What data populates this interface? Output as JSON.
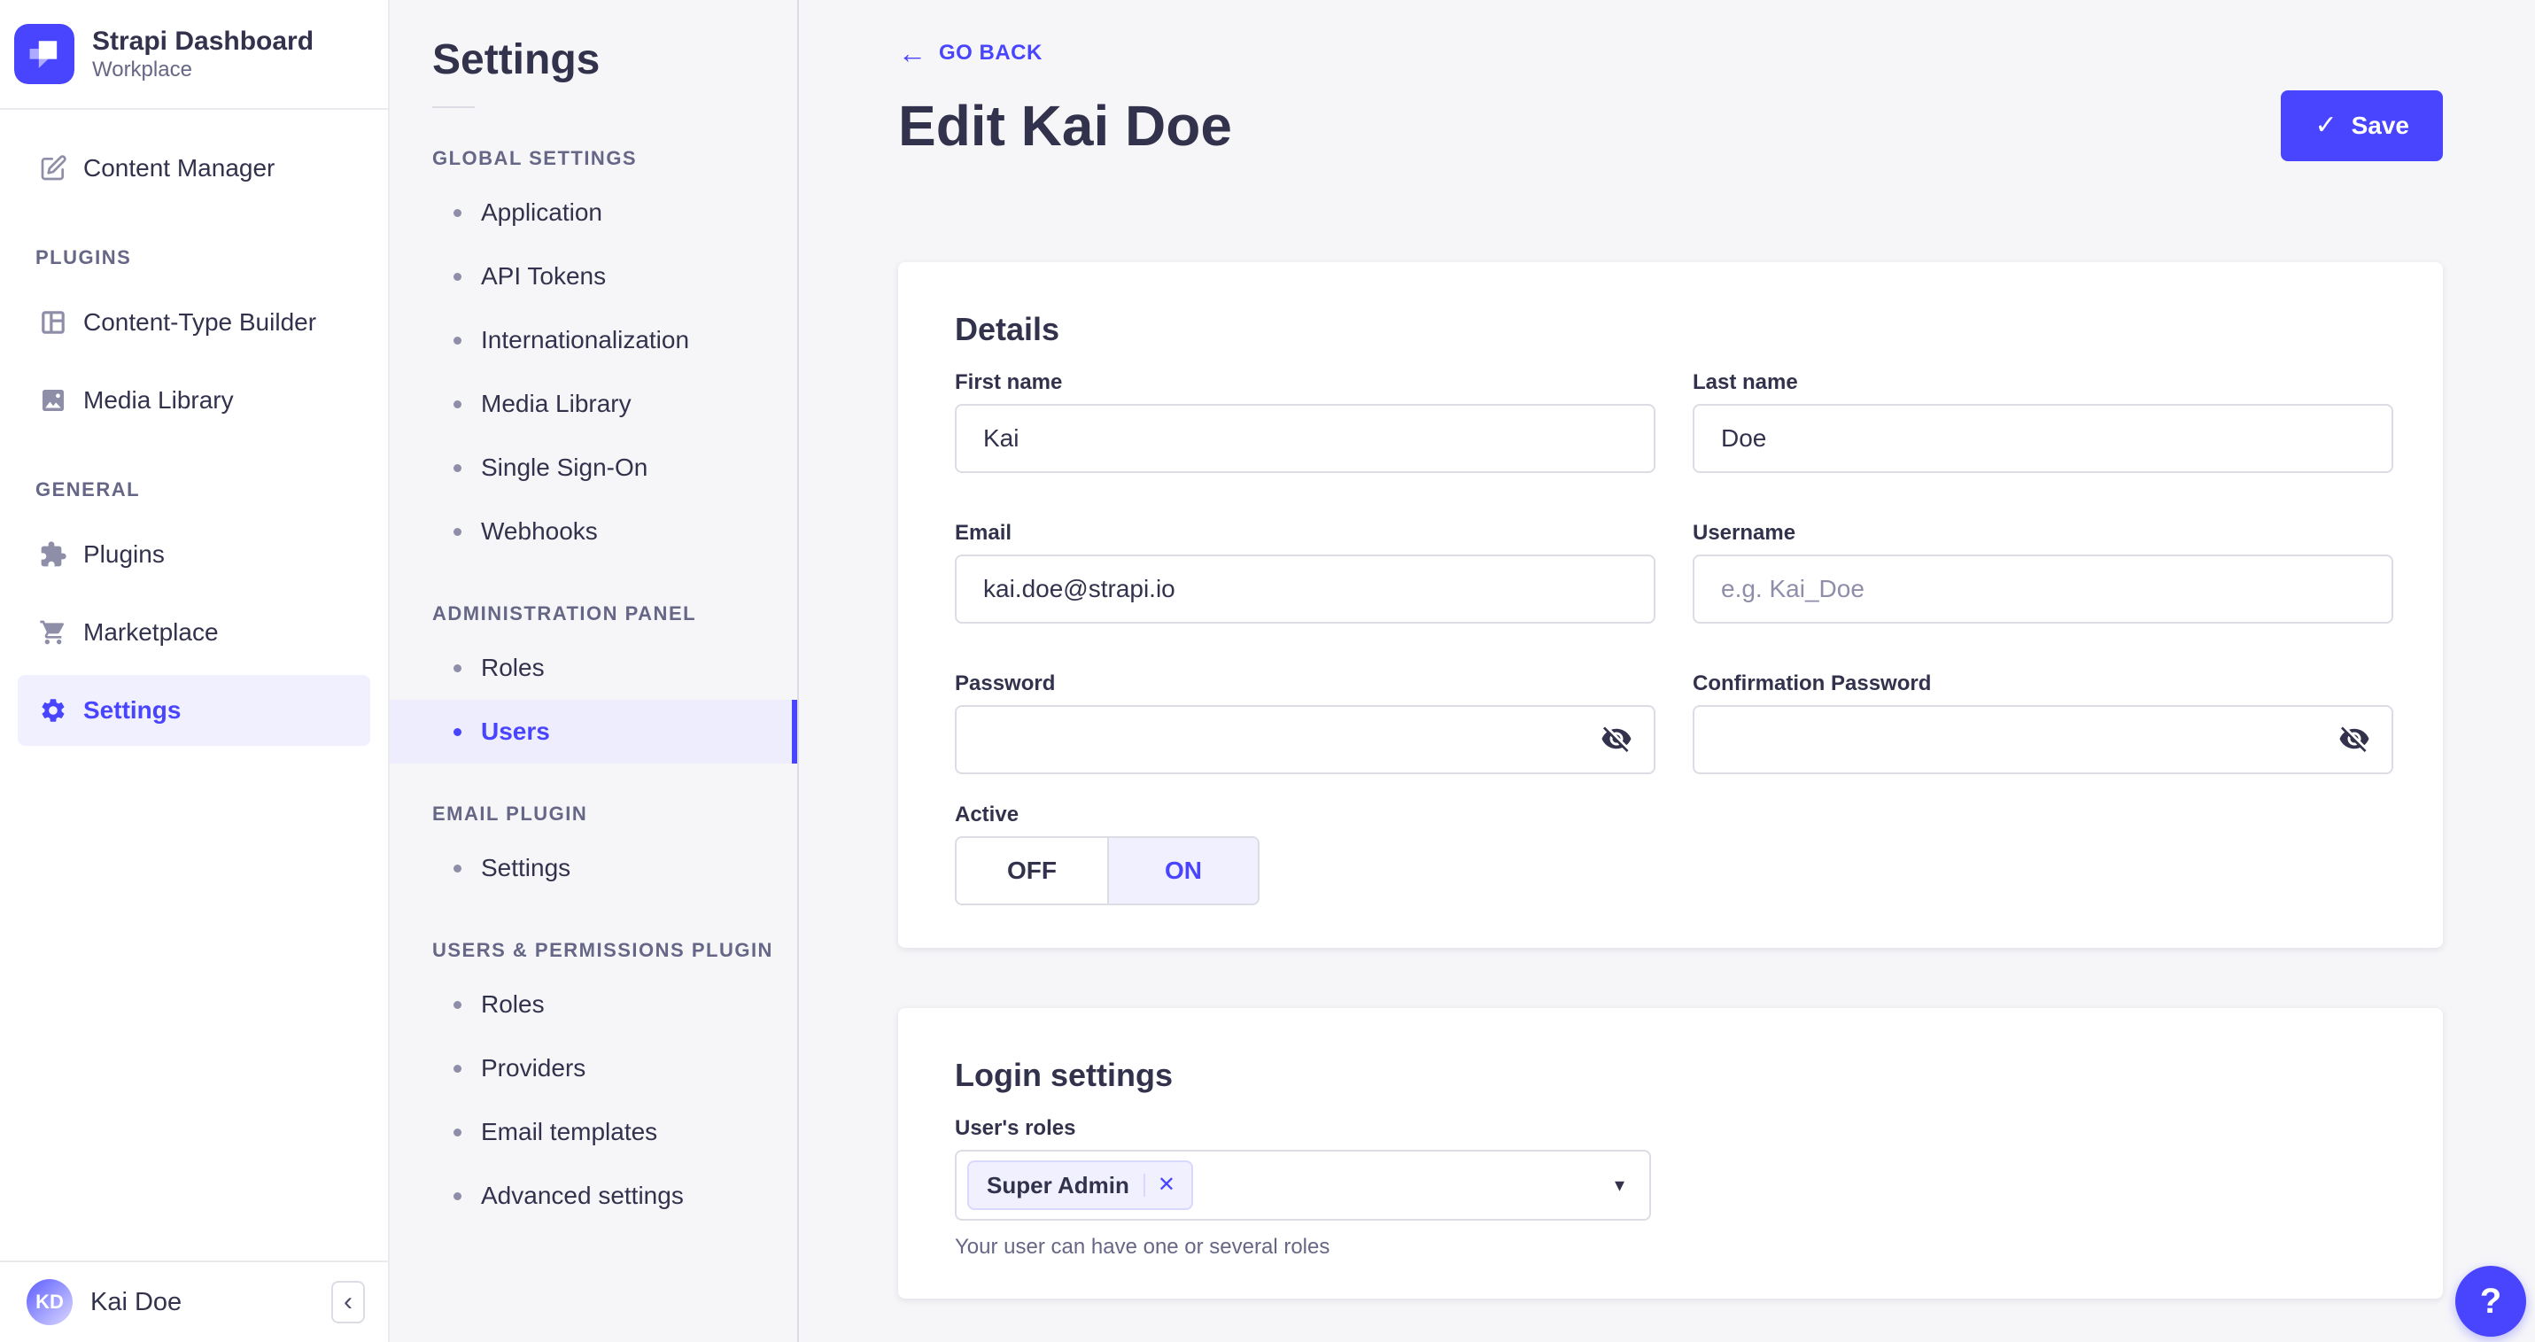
{
  "colors": {
    "primary": "#4945FF",
    "primary-light": "#F0F0FF",
    "primary-border": "#D9D8FF",
    "text": "#32324D",
    "text-muted": "#666687",
    "text-placeholder": "#8E8EA9",
    "border": "#DCDCE4",
    "divider": "#EAEAEF",
    "bg": "#F6F6F9",
    "white": "#FFFFFF"
  },
  "app_header": {
    "title": "Strapi Dashboard",
    "subtitle": "Workplace"
  },
  "sidebar": {
    "content_manager": "Content Manager",
    "sections": [
      {
        "title": "PLUGINS",
        "items": [
          {
            "label": "Content-Type Builder"
          },
          {
            "label": "Media Library"
          }
        ]
      },
      {
        "title": "GENERAL",
        "items": [
          {
            "label": "Plugins"
          },
          {
            "label": "Marketplace"
          },
          {
            "label": "Settings"
          }
        ]
      }
    ],
    "user": {
      "initials": "KD",
      "name": "Kai Doe"
    },
    "collapse_glyph": "‹"
  },
  "subnav": {
    "title": "Settings",
    "sections": [
      {
        "title": "GLOBAL SETTINGS",
        "items": [
          {
            "label": "Application"
          },
          {
            "label": "API Tokens"
          },
          {
            "label": "Internationalization"
          },
          {
            "label": "Media Library"
          },
          {
            "label": "Single Sign-On"
          },
          {
            "label": "Webhooks"
          }
        ]
      },
      {
        "title": "ADMINISTRATION PANEL",
        "items": [
          {
            "label": "Roles"
          },
          {
            "label": "Users"
          }
        ]
      },
      {
        "title": "EMAIL PLUGIN",
        "items": [
          {
            "label": "Settings"
          }
        ]
      },
      {
        "title": "USERS & PERMISSIONS PLUGIN",
        "items": [
          {
            "label": "Roles"
          },
          {
            "label": "Providers"
          },
          {
            "label": "Email templates"
          },
          {
            "label": "Advanced settings"
          }
        ]
      }
    ]
  },
  "page": {
    "back_arrow": "←",
    "back_label": "GO BACK",
    "title": "Edit Kai Doe",
    "save_check": "✓",
    "save_label": "Save"
  },
  "details": {
    "heading": "Details",
    "first_name": {
      "label": "First name",
      "value": "Kai"
    },
    "last_name": {
      "label": "Last name",
      "value": "Doe"
    },
    "email": {
      "label": "Email",
      "value": "kai.doe@strapi.io"
    },
    "username": {
      "label": "Username",
      "placeholder": "e.g. Kai_Doe"
    },
    "password": {
      "label": "Password"
    },
    "confirm_password": {
      "label": "Confirmation Password"
    },
    "active": {
      "label": "Active",
      "off": "OFF",
      "on": "ON",
      "selected": "ON"
    }
  },
  "login": {
    "heading": "Login settings",
    "roles": {
      "label": "User's roles",
      "selected": [
        {
          "name": "Super Admin"
        }
      ],
      "remove_glyph": "✕",
      "caret": "▾",
      "helper": "Your user can have one or several roles"
    }
  },
  "help": {
    "label": "?"
  }
}
